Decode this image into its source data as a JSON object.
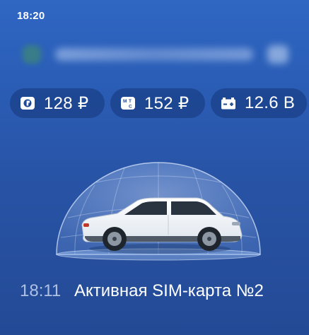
{
  "status_bar": {
    "time": "18:20"
  },
  "indicators": [
    {
      "icon": "sim-balance-icon",
      "value": "128 ₽"
    },
    {
      "icon": "mts-balance-icon",
      "value": "152 ₽"
    },
    {
      "icon": "battery-icon",
      "value": "12.6 В"
    }
  ],
  "vehicle": {
    "icon": "car-in-shield-dome-image"
  },
  "footer": {
    "time": "18:11",
    "sim_status": "Активная SIM-карта №2"
  },
  "colors": {
    "background_top": "#2f67c3",
    "background_bottom": "#234a95",
    "chip_background": "#1d4285",
    "text": "#ffffff",
    "muted_text": "#c8d5f0"
  }
}
